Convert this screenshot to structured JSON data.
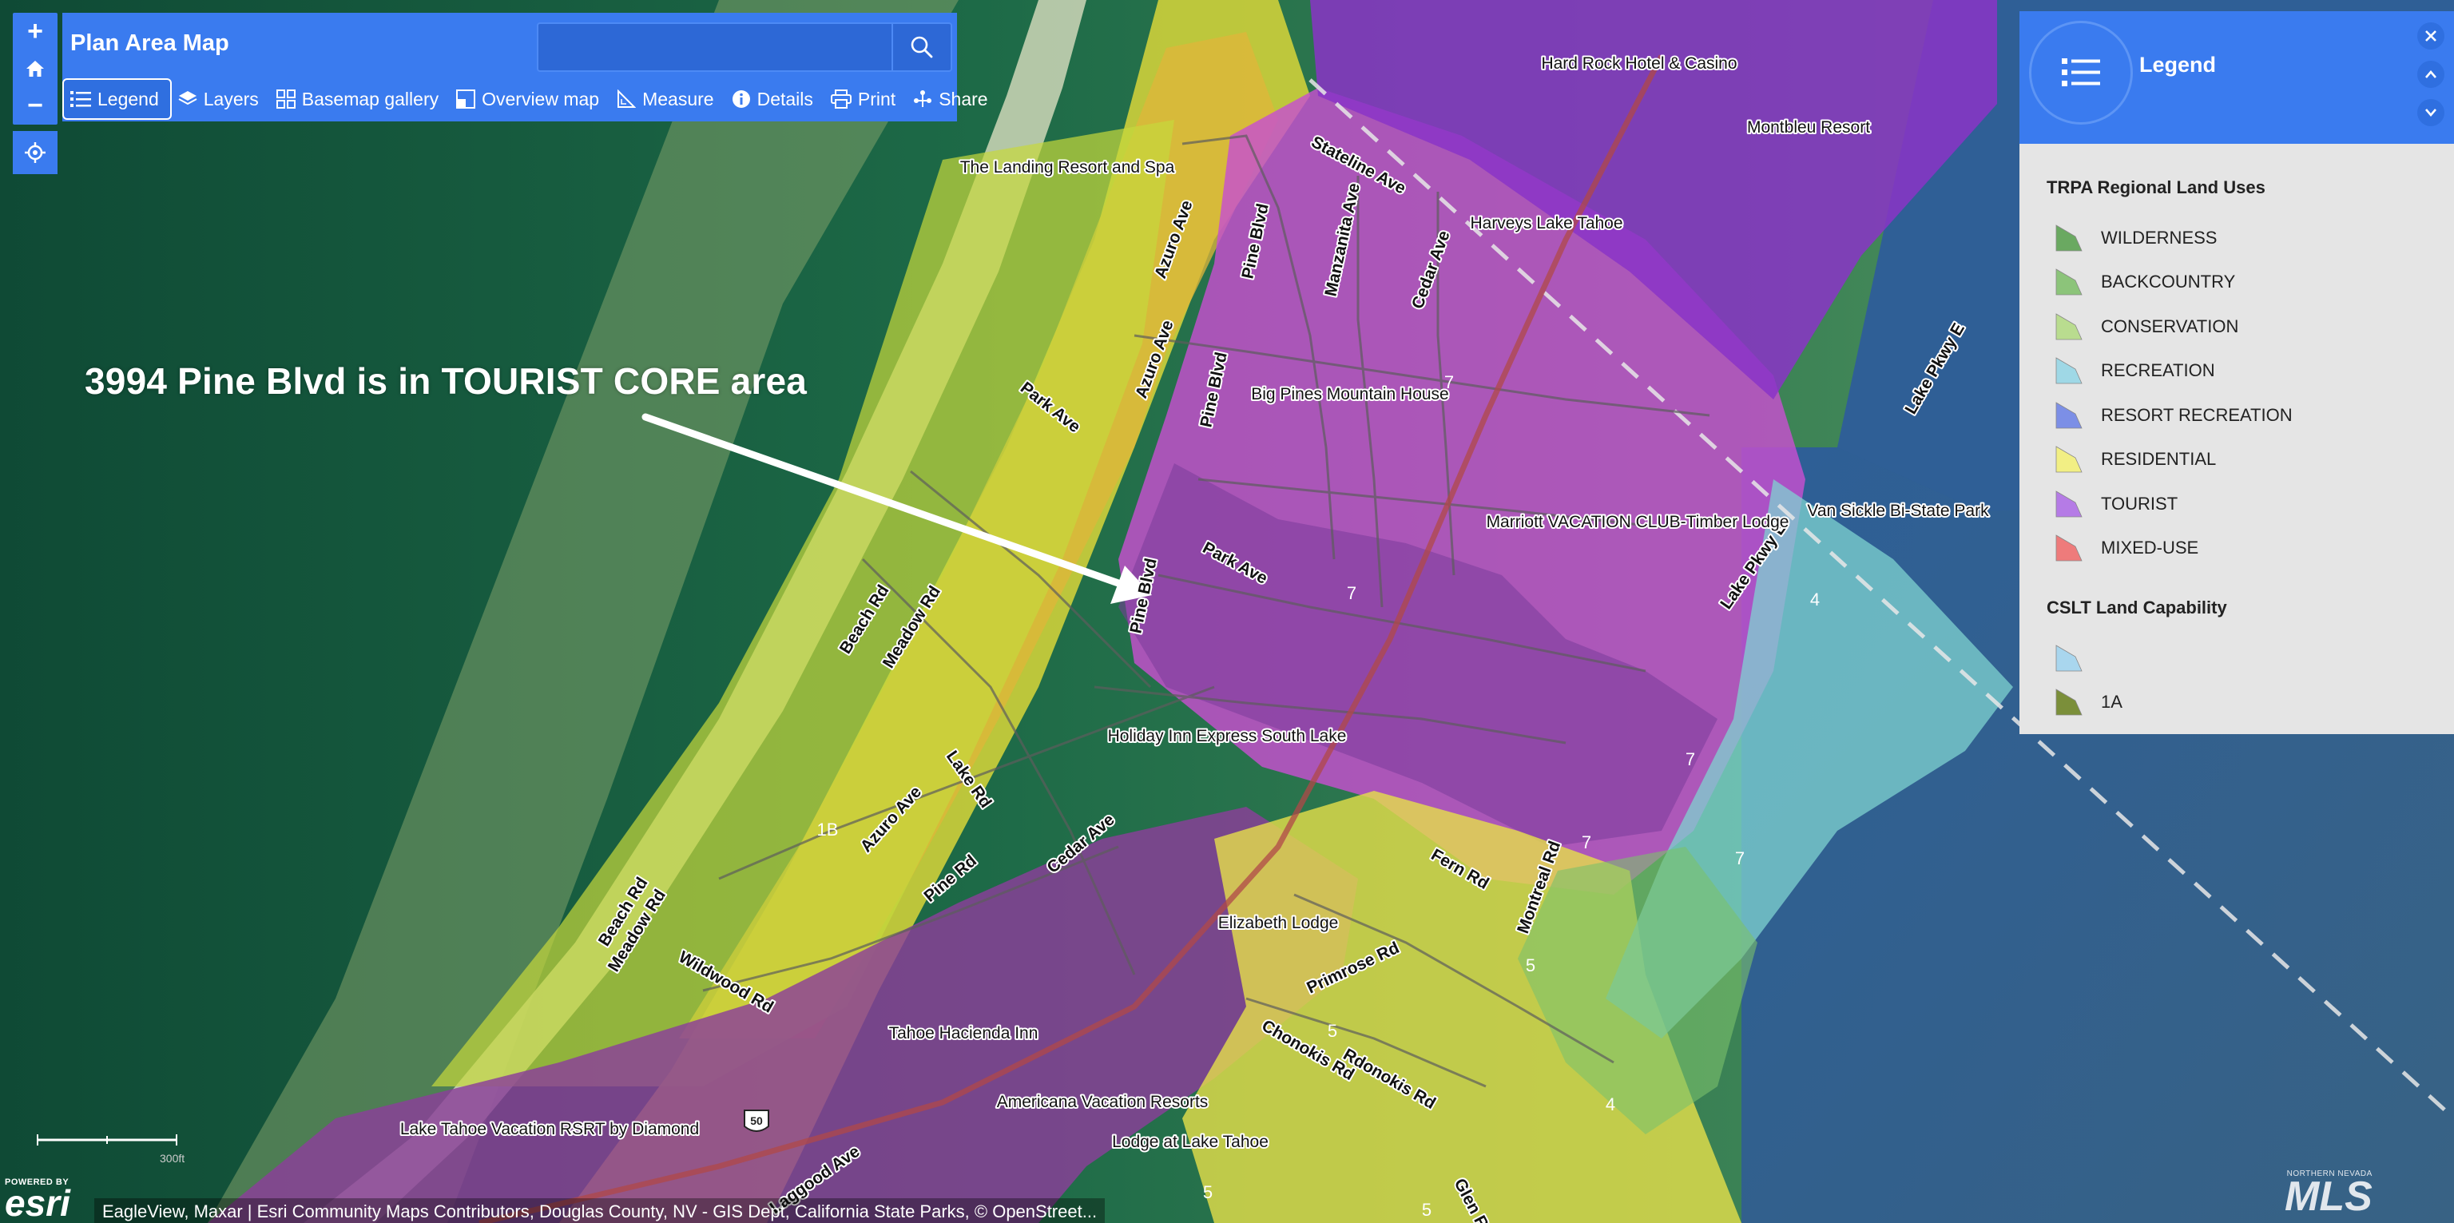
{
  "app": {
    "title": "Plan Area Map"
  },
  "search": {
    "placeholder": "",
    "button_icon": "search-icon"
  },
  "zoom": {
    "zoom_in": "+",
    "home_icon": "home-icon",
    "zoom_out": "−",
    "locate_icon": "locate-icon"
  },
  "toolbar": {
    "items": [
      {
        "label": "Legend",
        "icon": "list-icon",
        "active": true
      },
      {
        "label": "Layers",
        "icon": "layers-icon"
      },
      {
        "label": "Basemap gallery",
        "icon": "grid-icon"
      },
      {
        "label": "Overview map",
        "icon": "overview-icon"
      },
      {
        "label": "Measure",
        "icon": "ruler-icon"
      },
      {
        "label": "Details",
        "icon": "info-icon"
      },
      {
        "label": "Print",
        "icon": "printer-icon"
      },
      {
        "label": "Share",
        "icon": "share-icon"
      }
    ]
  },
  "annotation": "3994 Pine Blvd is in TOURIST CORE area",
  "legend": {
    "title": "Legend",
    "groups": [
      {
        "title": "TRPA Regional Land Uses",
        "items": [
          {
            "label": "WILDERNESS",
            "color": "#6aa961"
          },
          {
            "label": "BACKCOUNTRY",
            "color": "#8cc47a"
          },
          {
            "label": "CONSERVATION",
            "color": "#b9dc8f"
          },
          {
            "label": "RECREATION",
            "color": "#9fd8e6"
          },
          {
            "label": "RESORT RECREATION",
            "color": "#7c8fe6"
          },
          {
            "label": "RESIDENTIAL",
            "color": "#f2ef84"
          },
          {
            "label": "TOURIST",
            "color": "#b57be6"
          },
          {
            "label": "MIXED-USE",
            "color": "#ee7b7b"
          }
        ]
      },
      {
        "title": "CSLT Land Capability",
        "items": [
          {
            "label": "",
            "color": "#a9d6ee"
          },
          {
            "label": "1A",
            "color": "#7b8f3a"
          }
        ]
      }
    ]
  },
  "map": {
    "roads": [
      "Stateline Ave",
      "Pine Blvd",
      "Manzanita Ave",
      "Cedar Ave",
      "Azuro Ave",
      "Park Ave",
      "Beach Rd",
      "Meadow Rd",
      "Lake Rd",
      "Pine Rd",
      "Fern Rd",
      "Montreal Rd",
      "Primrose Rd",
      "Chonokis Rd",
      "Rdonokis Rd",
      "Wildwood Rd",
      "Lake Pkwy E",
      "Glen Rd",
      "Laggood Ave"
    ],
    "places": [
      "Hard Rock Hotel & Casino",
      "Montbleu Resort",
      "Harveys Lake Tahoe",
      "The Landing Resort and Spa",
      "Big Pines Mountain House",
      "Marriott VACATION CLUB-Timber Lodge",
      "Van Sickle Bi-State Park",
      "Holiday Inn Express South Lake",
      "Elizabeth Lodge",
      "Tahoe Hacienda Inn",
      "Americana Vacation Resorts",
      "Lodge at Lake Tahoe",
      "Lake Tahoe Vacation RSRT by Diamond"
    ],
    "capability_labels": [
      "7",
      "7",
      "7",
      "7",
      "7",
      "4",
      "4",
      "5",
      "5",
      "5",
      "5",
      "1B"
    ],
    "highway_shield": "50"
  },
  "scale": {
    "label": "300ft"
  },
  "attribution": "EagleView, Maxar | Esri Community Maps Contributors, Douglas County, NV - GIS Dept, California State Parks, © OpenStreet...",
  "esri": {
    "powered": "POWERED BY",
    "word": "esri"
  },
  "watermark": {
    "small": "NORTHERN NEVADA",
    "big": "MLS"
  }
}
